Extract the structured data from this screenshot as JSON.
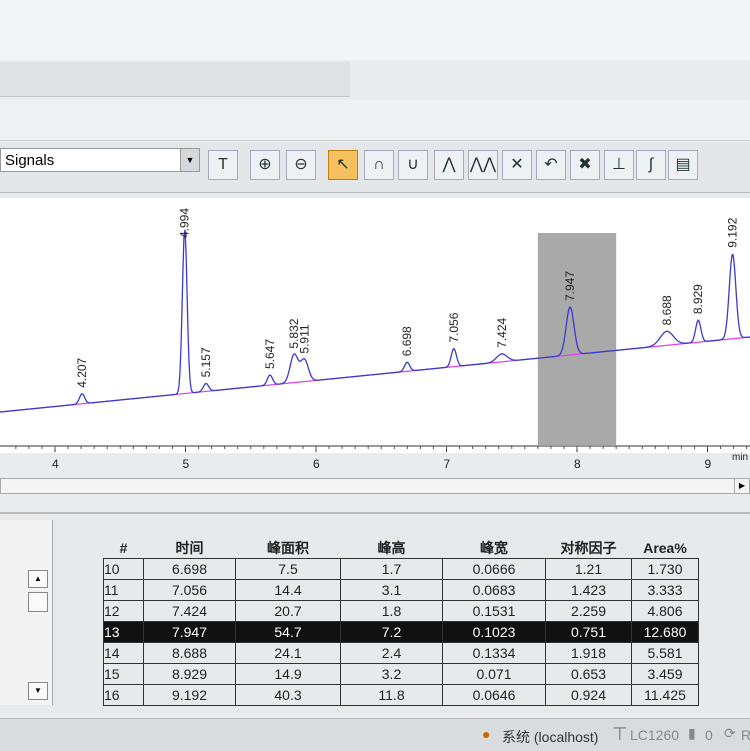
{
  "toolbar": {
    "signal_select": "Signals",
    "buttons": [
      {
        "icon": "color-palette-icon",
        "glyph": "T"
      },
      {
        "icon": "zoom-in-icon",
        "glyph": "⊕"
      },
      {
        "icon": "zoom-out-icon",
        "glyph": "⊖"
      },
      {
        "icon": "pointer-icon",
        "glyph": "↖",
        "selected": true
      },
      {
        "icon": "peak-icon",
        "glyph": "∩"
      },
      {
        "icon": "valley-icon",
        "glyph": "∪"
      },
      {
        "icon": "split-peak-icon",
        "glyph": "⋀"
      },
      {
        "icon": "multi-peak-icon",
        "glyph": "⋀⋀"
      },
      {
        "icon": "delete-peak-icon",
        "glyph": "✕"
      },
      {
        "icon": "undo-icon",
        "glyph": "↶"
      },
      {
        "icon": "remove-icon",
        "glyph": "✖"
      },
      {
        "icon": "baseline-icon",
        "glyph": "⊥"
      },
      {
        "icon": "integrate-icon",
        "glyph": "∫"
      },
      {
        "icon": "report-icon",
        "glyph": "▤"
      }
    ]
  },
  "chromatogram": {
    "x_unit": "min",
    "x_ticks": [
      "4",
      "5",
      "6",
      "7",
      "8",
      "9"
    ],
    "peak_labels": [
      "4.207",
      "4.994",
      "5.157",
      "5.647",
      "5.832",
      "5.911",
      "6.698",
      "7.056",
      "7.424",
      "7.947",
      "8.688",
      "8.929",
      "9.192"
    ],
    "selected_range": [
      7.7,
      8.3
    ],
    "trace_color": "#3a3ad0",
    "baseline_color": "#e040e0"
  },
  "table": {
    "headers": [
      "#",
      "时间",
      "峰面积",
      "峰高",
      "峰宽",
      "对称因子",
      "Area%"
    ],
    "rows": [
      [
        "10",
        "6.698",
        "7.5",
        "1.7",
        "0.0666",
        "1.21",
        "1.730"
      ],
      [
        "11",
        "7.056",
        "14.4",
        "3.1",
        "0.0683",
        "1.423",
        "3.333"
      ],
      [
        "12",
        "7.424",
        "20.7",
        "1.8",
        "0.1531",
        "2.259",
        "4.806"
      ],
      [
        "13",
        "7.947",
        "54.7",
        "7.2",
        "0.1023",
        "0.751",
        "12.680"
      ],
      [
        "14",
        "8.688",
        "24.1",
        "2.4",
        "0.1334",
        "1.918",
        "5.581"
      ],
      [
        "15",
        "8.929",
        "14.9",
        "3.2",
        "0.071",
        "0.653",
        "3.459"
      ],
      [
        "16",
        "9.192",
        "40.3",
        "11.8",
        "0.0646",
        "0.924",
        "11.425"
      ]
    ],
    "selected_row": 3
  },
  "status": {
    "user": "系统 (localhost)",
    "instrument": "LC1260",
    "count": "0",
    "extra": "R"
  }
}
